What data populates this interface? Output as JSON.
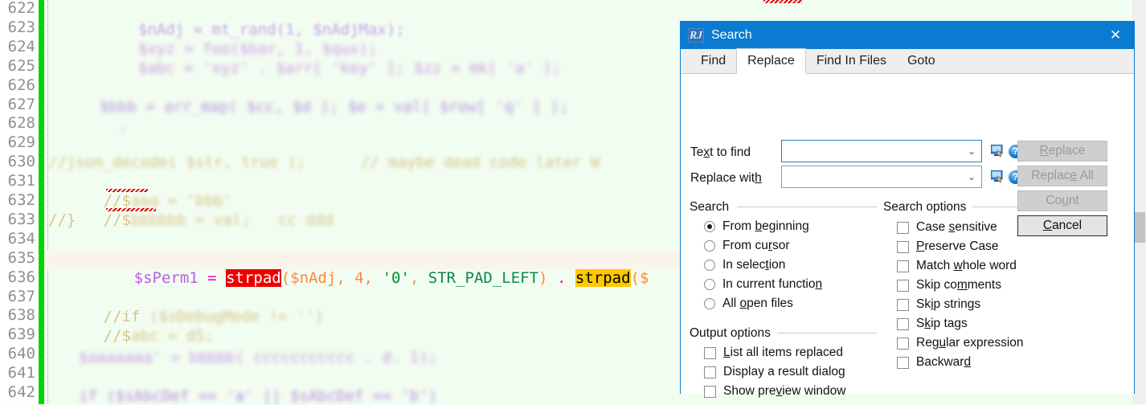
{
  "editor": {
    "line_numbers": [
      "622",
      "623",
      "624",
      "625",
      "626",
      "627",
      "628",
      "629",
      "630",
      "631",
      "632",
      "633",
      "634",
      "635",
      "636",
      "637",
      "638",
      "639",
      "640",
      "641",
      "642"
    ],
    "current_line": "635",
    "current_line_tokens": {
      "var1": "$sPerm1",
      "eq": "=",
      "fn_match": "strpad",
      "args1": "($nAdj, 4, ",
      "str0": "'0'",
      "comma": ", ",
      "const": "STR_PAD_LEFT",
      "close": ")",
      "concat": ".",
      "fn_match2": "strpad",
      "tail": "($"
    },
    "comment_lines": {
      "l630": "//j",
      "l631": "//$",
      "l632": "//$",
      "l633": "//}",
      "l637": "//if ($sDebugMode != '')",
      "l638": "//$"
    },
    "partially_visible_line_623": "$nAdj = mt_rand(1, $nAdjMax);",
    "scrollbar": {
      "name": "vertical-scrollbar"
    }
  },
  "dialog": {
    "icon": "rj-app-icon",
    "icon_text": "RJ",
    "title": "Search",
    "close_label": "✕",
    "tabs": [
      {
        "label": "Find",
        "active": false
      },
      {
        "label": "Replace",
        "active": true
      },
      {
        "label": "Find In Files",
        "active": false
      },
      {
        "label": "Goto",
        "active": false
      }
    ],
    "fields": [
      {
        "label_pre": "Te",
        "label_ak": "x",
        "label_post": "t to find",
        "value": "",
        "placeholder": "",
        "focused": true
      },
      {
        "label_pre": "Replace wit",
        "label_ak": "h",
        "label_post": "",
        "value": "",
        "placeholder": "",
        "focused": false
      }
    ],
    "search_group": {
      "title": "Search",
      "options": [
        {
          "pre": "From ",
          "ak": "b",
          "post": "eginning",
          "checked": true
        },
        {
          "pre": "From cu",
          "ak": "r",
          "post": "sor",
          "checked": false
        },
        {
          "pre": "In selec",
          "ak": "t",
          "post": "ion",
          "checked": false
        },
        {
          "pre": "In current functio",
          "ak": "n",
          "post": "",
          "checked": false
        },
        {
          "pre": "All ",
          "ak": "o",
          "post": "pen files",
          "checked": false
        }
      ]
    },
    "search_options_group": {
      "title": "Search options",
      "options": [
        {
          "pre": "Case ",
          "ak": "s",
          "post": "ensitive",
          "checked": false
        },
        {
          "pre": "",
          "ak": "P",
          "post": "reserve Case",
          "checked": false
        },
        {
          "pre": "Match ",
          "ak": "w",
          "post": "hole word",
          "checked": false
        },
        {
          "pre": "Skip co",
          "ak": "m",
          "post": "ments",
          "checked": false
        },
        {
          "pre": "Sk",
          "ak": "i",
          "post": "p strings",
          "checked": false
        },
        {
          "pre": "S",
          "ak": "k",
          "post": "ip tags",
          "checked": false
        },
        {
          "pre": "Reg",
          "ak": "u",
          "post": "lar expression",
          "checked": false
        },
        {
          "pre": "Backwar",
          "ak": "d",
          "post": "",
          "checked": false
        }
      ]
    },
    "output_options_group": {
      "title": "Output options",
      "options": [
        {
          "pre": "",
          "ak": "L",
          "post": "ist all items replaced",
          "checked": false
        },
        {
          "pre": "Display a result dialo",
          "ak": "g",
          "post": "",
          "checked": false
        },
        {
          "pre": "Show pre",
          "ak": "v",
          "post": "iew window",
          "checked": false
        }
      ]
    },
    "buttons": [
      {
        "pre": "",
        "ak": "R",
        "post": "eplace",
        "enabled": false
      },
      {
        "pre": "Replac",
        "ak": "e",
        "post": " All",
        "enabled": false
      },
      {
        "pre": "Co",
        "ak": "u",
        "post": "nt",
        "enabled": false
      },
      {
        "pre": "",
        "ak": "C",
        "post": "ancel",
        "enabled": true
      }
    ],
    "field_icons": [
      {
        "pick": "insert-special-icon",
        "help": "help-icon"
      },
      {
        "pick": "insert-special-icon",
        "help": "help-icon"
      }
    ]
  },
  "colors": {
    "accent": "#0a7bd0",
    "editor_bg": "#f2fdf1",
    "changebar": "#00d400",
    "match_current": "#ee0000",
    "match_other": "#ffc800"
  }
}
